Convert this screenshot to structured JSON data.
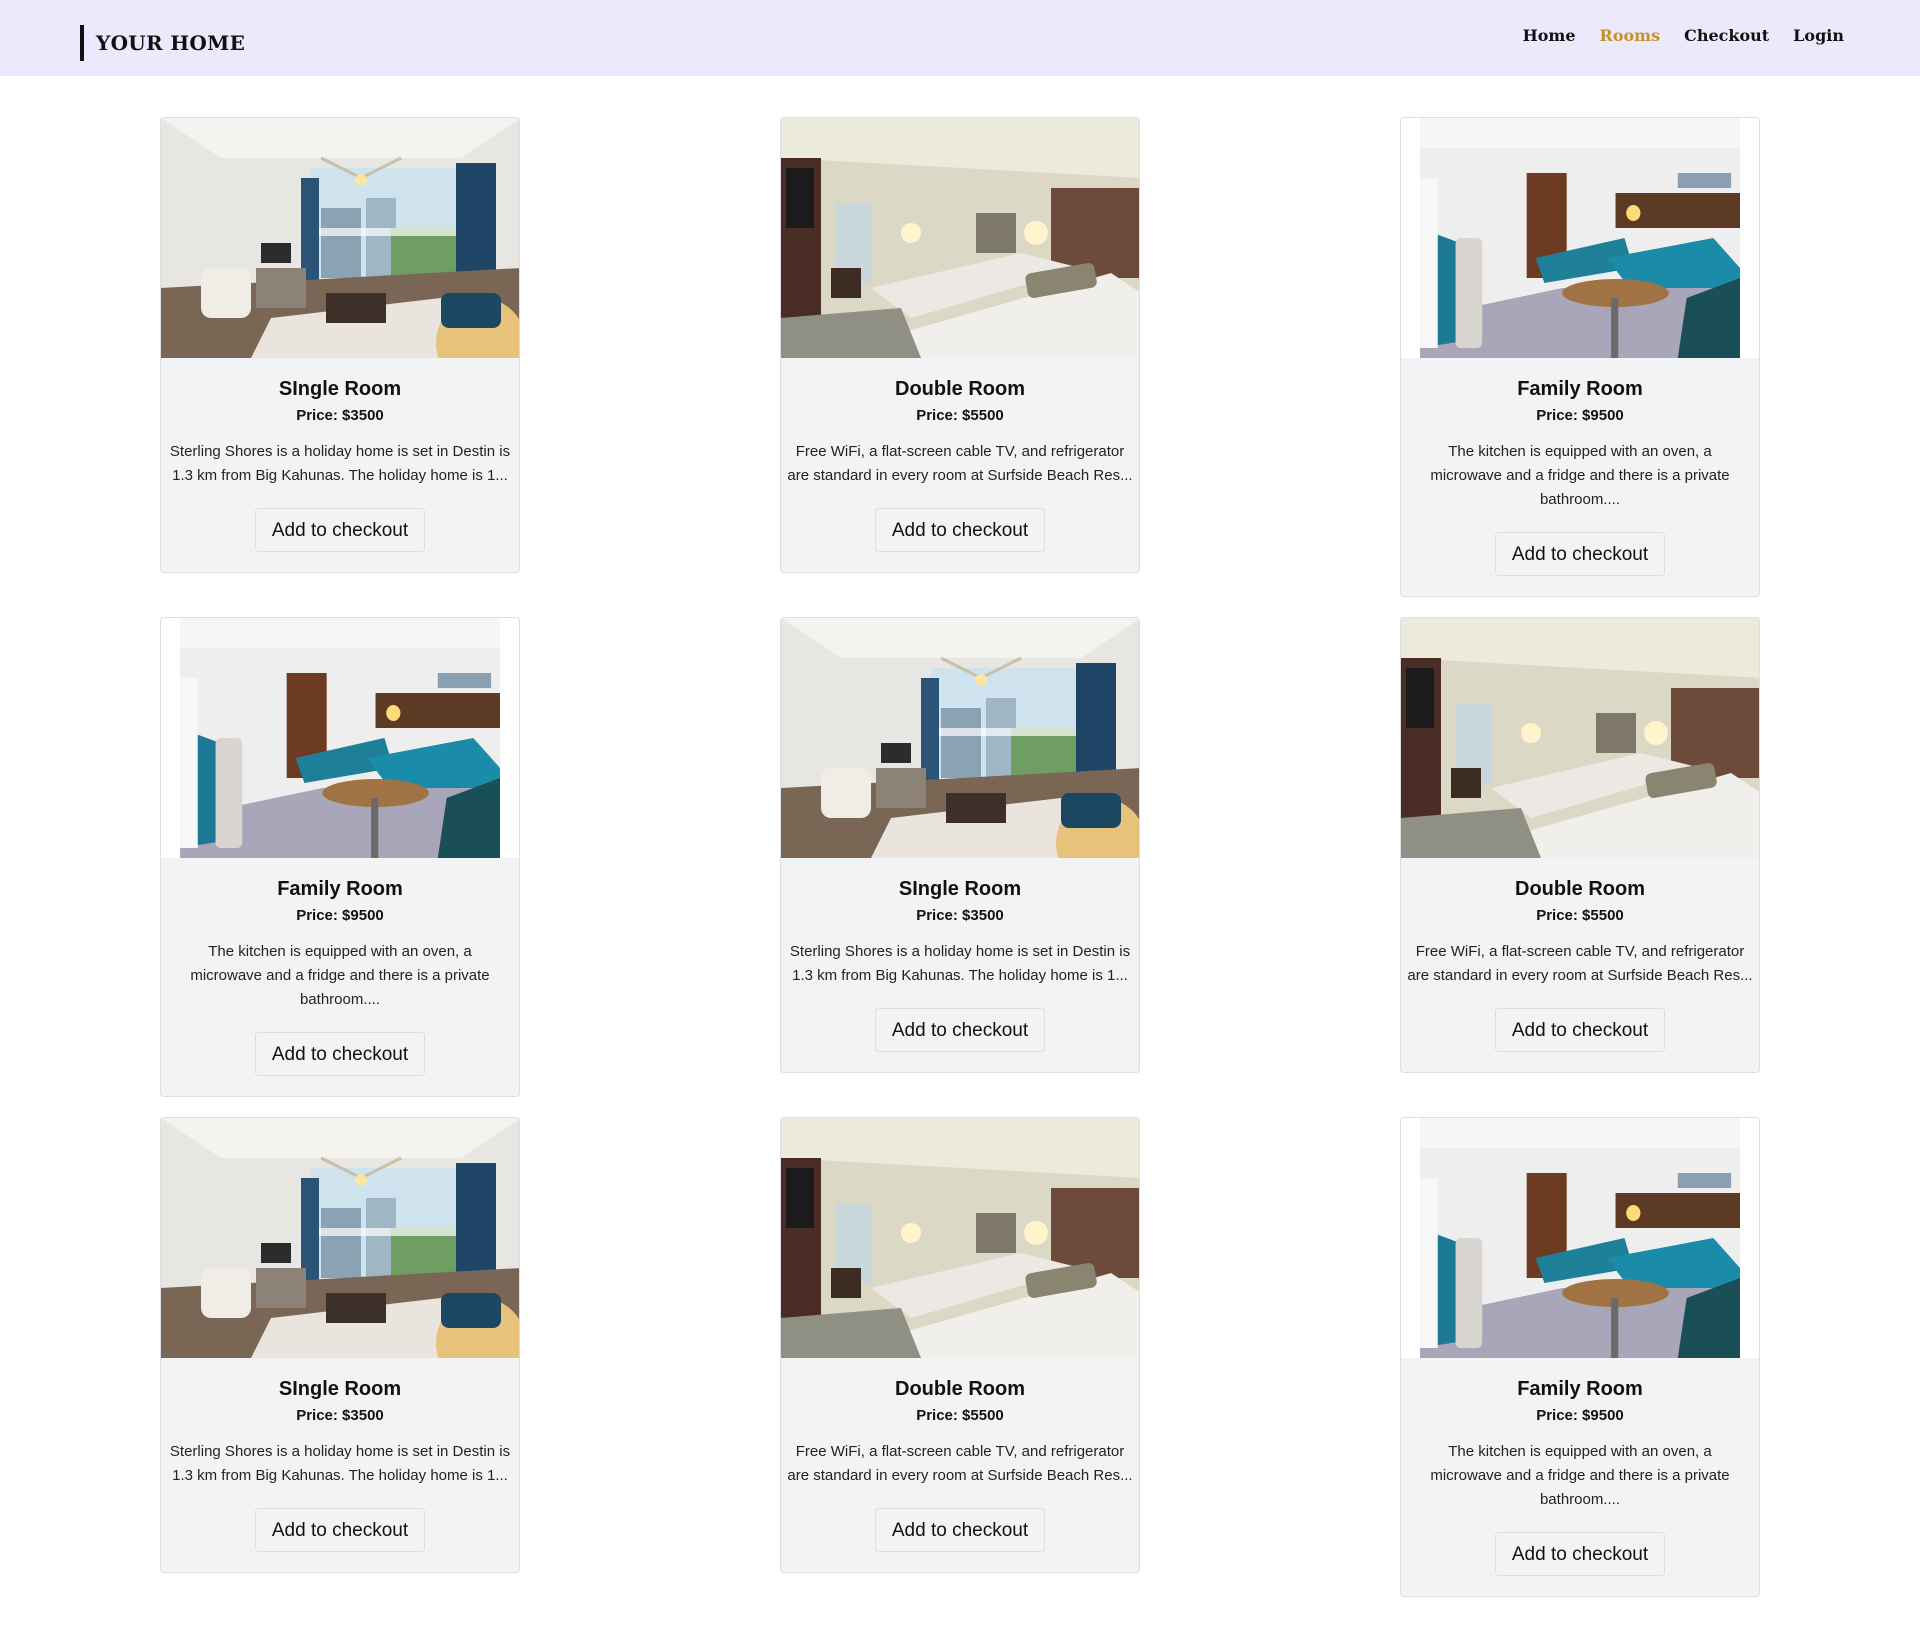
{
  "nav": {
    "brand": "YOUR HOME",
    "links": [
      {
        "label": "Home",
        "active": false
      },
      {
        "label": "Rooms",
        "active": true
      },
      {
        "label": "Checkout",
        "active": false
      },
      {
        "label": "Login",
        "active": false
      }
    ],
    "active_color": "#c8902a"
  },
  "rooms": [
    {
      "type": "single",
      "title": "SIngle Room",
      "price": "Price: $3500",
      "desc_lines": [
        "Sterling Shores is a holiday home is set in Destin is",
        "1.3 km from Big Kahunas. The holiday home is 1..."
      ],
      "button": "Add to checkout"
    },
    {
      "type": "double",
      "title": "Double Room",
      "price": "Price: $5500",
      "desc_lines": [
        "Free WiFi, a flat-screen cable TV, and refrigerator",
        "are standard in every room at Surfside Beach Res..."
      ],
      "button": "Add to checkout"
    },
    {
      "type": "family",
      "title": "Family Room",
      "price": "Price: $9500",
      "desc_lines": [
        "The kitchen is equipped with an oven, a",
        "microwave and a fridge and there is a private",
        "bathroom...."
      ],
      "button": "Add to checkout"
    },
    {
      "type": "family",
      "title": "Family Room",
      "price": "Price: $9500",
      "desc_lines": [
        "The kitchen is equipped with an oven, a",
        "microwave and a fridge and there is a private",
        "bathroom...."
      ],
      "button": "Add to checkout"
    },
    {
      "type": "single",
      "title": "SIngle Room",
      "price": "Price: $3500",
      "desc_lines": [
        "Sterling Shores is a holiday home is set in Destin is",
        "1.3 km from Big Kahunas. The holiday home is 1..."
      ],
      "button": "Add to checkout"
    },
    {
      "type": "double",
      "title": "Double Room",
      "price": "Price: $5500",
      "desc_lines": [
        "Free WiFi, a flat-screen cable TV, and refrigerator",
        "are standard in every room at Surfside Beach Res..."
      ],
      "button": "Add to checkout"
    },
    {
      "type": "single",
      "title": "SIngle Room",
      "price": "Price: $3500",
      "desc_lines": [
        "Sterling Shores is a holiday home is set in Destin is",
        "1.3 km from Big Kahunas. The holiday home is 1..."
      ],
      "button": "Add to checkout"
    },
    {
      "type": "double",
      "title": "Double Room",
      "price": "Price: $5500",
      "desc_lines": [
        "Free WiFi, a flat-screen cable TV, and refrigerator",
        "are standard in every room at Surfside Beach Res..."
      ],
      "button": "Add to checkout"
    },
    {
      "type": "family",
      "title": "Family Room",
      "price": "Price: $9500",
      "desc_lines": [
        "The kitchen is equipped with an oven, a",
        "microwave and a fridge and there is a private",
        "bathroom...."
      ],
      "button": "Add to checkout"
    }
  ]
}
